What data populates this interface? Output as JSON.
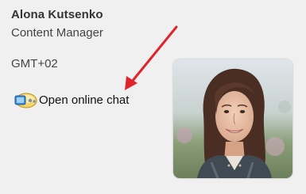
{
  "profile": {
    "name": "Alona Kutsenko",
    "role": "Content Manager",
    "timezone": "GMT+02",
    "chat_label": "Open online chat",
    "chat_icon": "chat-bubble-icon",
    "photo_alt": "Alona Kutsenko"
  },
  "colors": {
    "annotation_arrow": "#e0242c"
  }
}
